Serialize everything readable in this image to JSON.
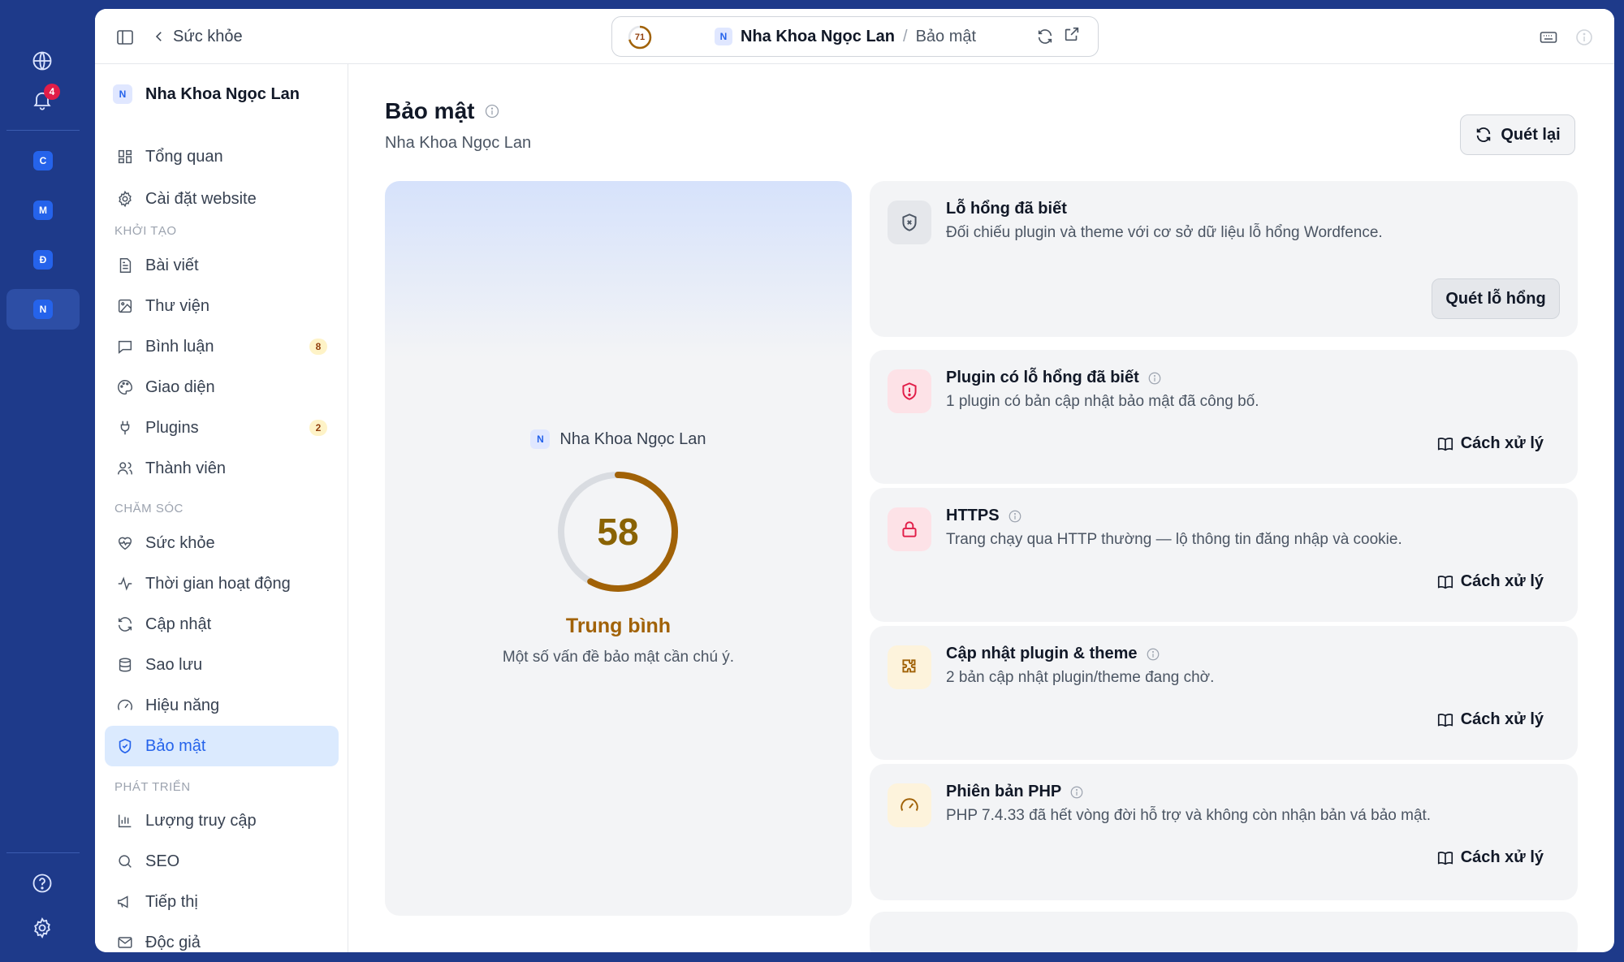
{
  "rail": {
    "notification_count": "4",
    "sites": [
      "C",
      "M",
      "Đ",
      "N"
    ]
  },
  "topbar": {
    "back_label": "Sức khỏe",
    "health_score": "71",
    "site_chip": "N",
    "site_name": "Nha Khoa Ngọc Lan",
    "separator": "/",
    "page_name": "Bảo mật"
  },
  "sidebar": {
    "site_chip": "N",
    "site_name": "Nha Khoa Ngọc Lan",
    "top_items": [
      {
        "label": "Tổng quan",
        "icon": "dashboard-icon"
      },
      {
        "label": "Cài đặt website",
        "icon": "gear-icon"
      }
    ],
    "sections": [
      {
        "title": "Khởi tạo",
        "items": [
          {
            "label": "Bài viết",
            "icon": "document-icon",
            "count": ""
          },
          {
            "label": "Thư viện",
            "icon": "image-icon",
            "count": ""
          },
          {
            "label": "Bình luận",
            "icon": "comment-icon",
            "count": "8"
          },
          {
            "label": "Giao diện",
            "icon": "palette-icon",
            "count": ""
          },
          {
            "label": "Plugins",
            "icon": "plug-icon",
            "count": "2"
          },
          {
            "label": "Thành viên",
            "icon": "users-icon",
            "count": ""
          }
        ]
      },
      {
        "title": "Chăm sóc",
        "items": [
          {
            "label": "Sức khỏe",
            "icon": "heart-pulse-icon"
          },
          {
            "label": "Thời gian hoạt động",
            "icon": "activity-icon"
          },
          {
            "label": "Cập nhật",
            "icon": "refresh-icon"
          },
          {
            "label": "Sao lưu",
            "icon": "database-icon"
          },
          {
            "label": "Hiệu năng",
            "icon": "gauge-icon"
          },
          {
            "label": "Bảo mật",
            "icon": "shield-check-icon"
          }
        ]
      },
      {
        "title": "Phát triển",
        "items": [
          {
            "label": "Lượng truy cập",
            "icon": "bar-chart-icon"
          },
          {
            "label": "SEO",
            "icon": "search-icon"
          },
          {
            "label": "Tiếp thị",
            "icon": "megaphone-icon"
          },
          {
            "label": "Độc giả",
            "icon": "mail-icon"
          }
        ]
      }
    ],
    "active_item": "Bảo mật"
  },
  "main": {
    "title": "Bảo mật",
    "subtitle": "Nha Khoa Ngọc Lan",
    "rescan_label": "Quét lại",
    "score_card": {
      "site_chip": "N",
      "site_name": "Nha Khoa Ngọc Lan",
      "score": "58",
      "score_fraction": 0.58,
      "level": "Trung bình",
      "description": "Một số vấn đề bảo mật cần chú ý."
    },
    "checks": [
      {
        "title": "Lỗ hổng đã biết",
        "description": "Đối chiếu plugin và theme với cơ sở dữ liệu lỗ hổng Wordfence.",
        "action": "Quét lỗ hổng",
        "icon": "shield-x-icon",
        "tone": "gray"
      },
      {
        "title": "Plugin có lỗ hổng đã biết",
        "description": "1 plugin có bản cập nhật bảo mật đã công bố.",
        "action": "Cách xử lý",
        "icon": "shield-alert-icon",
        "tone": "red"
      },
      {
        "title": "HTTPS",
        "description": "Trang chạy qua HTTP thường — lộ thông tin đăng nhập và cookie.",
        "action": "Cách xử lý",
        "icon": "lock-open-icon",
        "tone": "red"
      },
      {
        "title": "Cập nhật plugin & theme",
        "description": "2 bản cập nhật plugin/theme đang chờ.",
        "action": "Cách xử lý",
        "icon": "puzzle-icon",
        "tone": "amber"
      },
      {
        "title": "Phiên bản PHP",
        "description": "PHP 7.4.33 đã hết vòng đời hỗ trợ và không còn nhận bản vá bảo mật.",
        "action": "Cách xử lý",
        "icon": "speedometer-icon",
        "tone": "amber"
      }
    ]
  },
  "colors": {
    "rail_bg": "#1e3a8a",
    "accent": "#2563eb",
    "danger": "#e11d48",
    "warning": "#a16207"
  }
}
